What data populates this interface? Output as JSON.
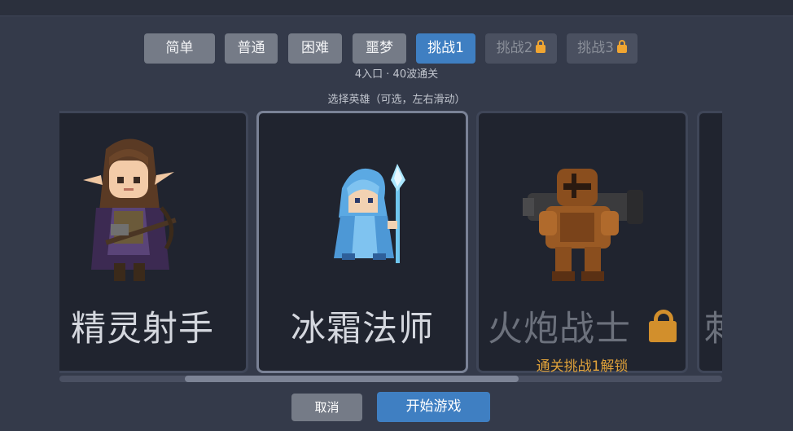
{
  "difficulty": {
    "buttons": [
      {
        "label": "简单",
        "state": "normal"
      },
      {
        "label": "普通",
        "state": "normal"
      },
      {
        "label": "困难",
        "state": "normal"
      },
      {
        "label": "噩梦",
        "state": "normal"
      },
      {
        "label": "挑战1",
        "state": "active"
      },
      {
        "label": "挑战2",
        "state": "locked",
        "icon": "lock-icon"
      },
      {
        "label": "挑战3",
        "state": "locked",
        "icon": "lock-icon"
      }
    ]
  },
  "level_info": "4入口 · 40波通关",
  "hero_hint": "选择英雄（可选，左右滑动）",
  "heroes": [
    {
      "name": "精灵射手",
      "state": "available"
    },
    {
      "name": "冰霜法师",
      "state": "selected"
    },
    {
      "name": "火炮战士",
      "state": "locked",
      "unlock_text": "通关挑战1解锁"
    },
    {
      "name": "刺",
      "state": "partial"
    }
  ],
  "scroll": {
    "position_fraction": 0.19,
    "visible_fraction": 0.5
  },
  "actions": {
    "cancel_label": "取消",
    "start_label": "开始游戏"
  },
  "colors": {
    "background": "#343a4a",
    "card": "#20242f",
    "accent": "#3f7fc2",
    "lock": "#f0a531",
    "unlock_text": "#e0a23a"
  }
}
